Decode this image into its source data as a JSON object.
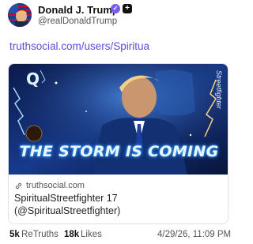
{
  "author": {
    "display_name": "Donald J. Trump",
    "handle": "@realDonaldTrump"
  },
  "post": {
    "link_text": "truthsocial.com/users/Spiritua"
  },
  "card": {
    "image_caption": "THE STORM IS COMING",
    "side_text": "Streetfighter",
    "domain": "truthsocial.com",
    "title": "SpiritualStreetfighter 17 (@SpiritualStreetfighter)"
  },
  "stats": {
    "retruths_count": "5k",
    "retruths_label": "ReTruths",
    "likes_count": "18k",
    "likes_label": "Likes",
    "timestamp": "4/29/26, 11:09 PM"
  },
  "colors": {
    "link": "#5b4fd6",
    "verified": "#7b5cf2"
  }
}
